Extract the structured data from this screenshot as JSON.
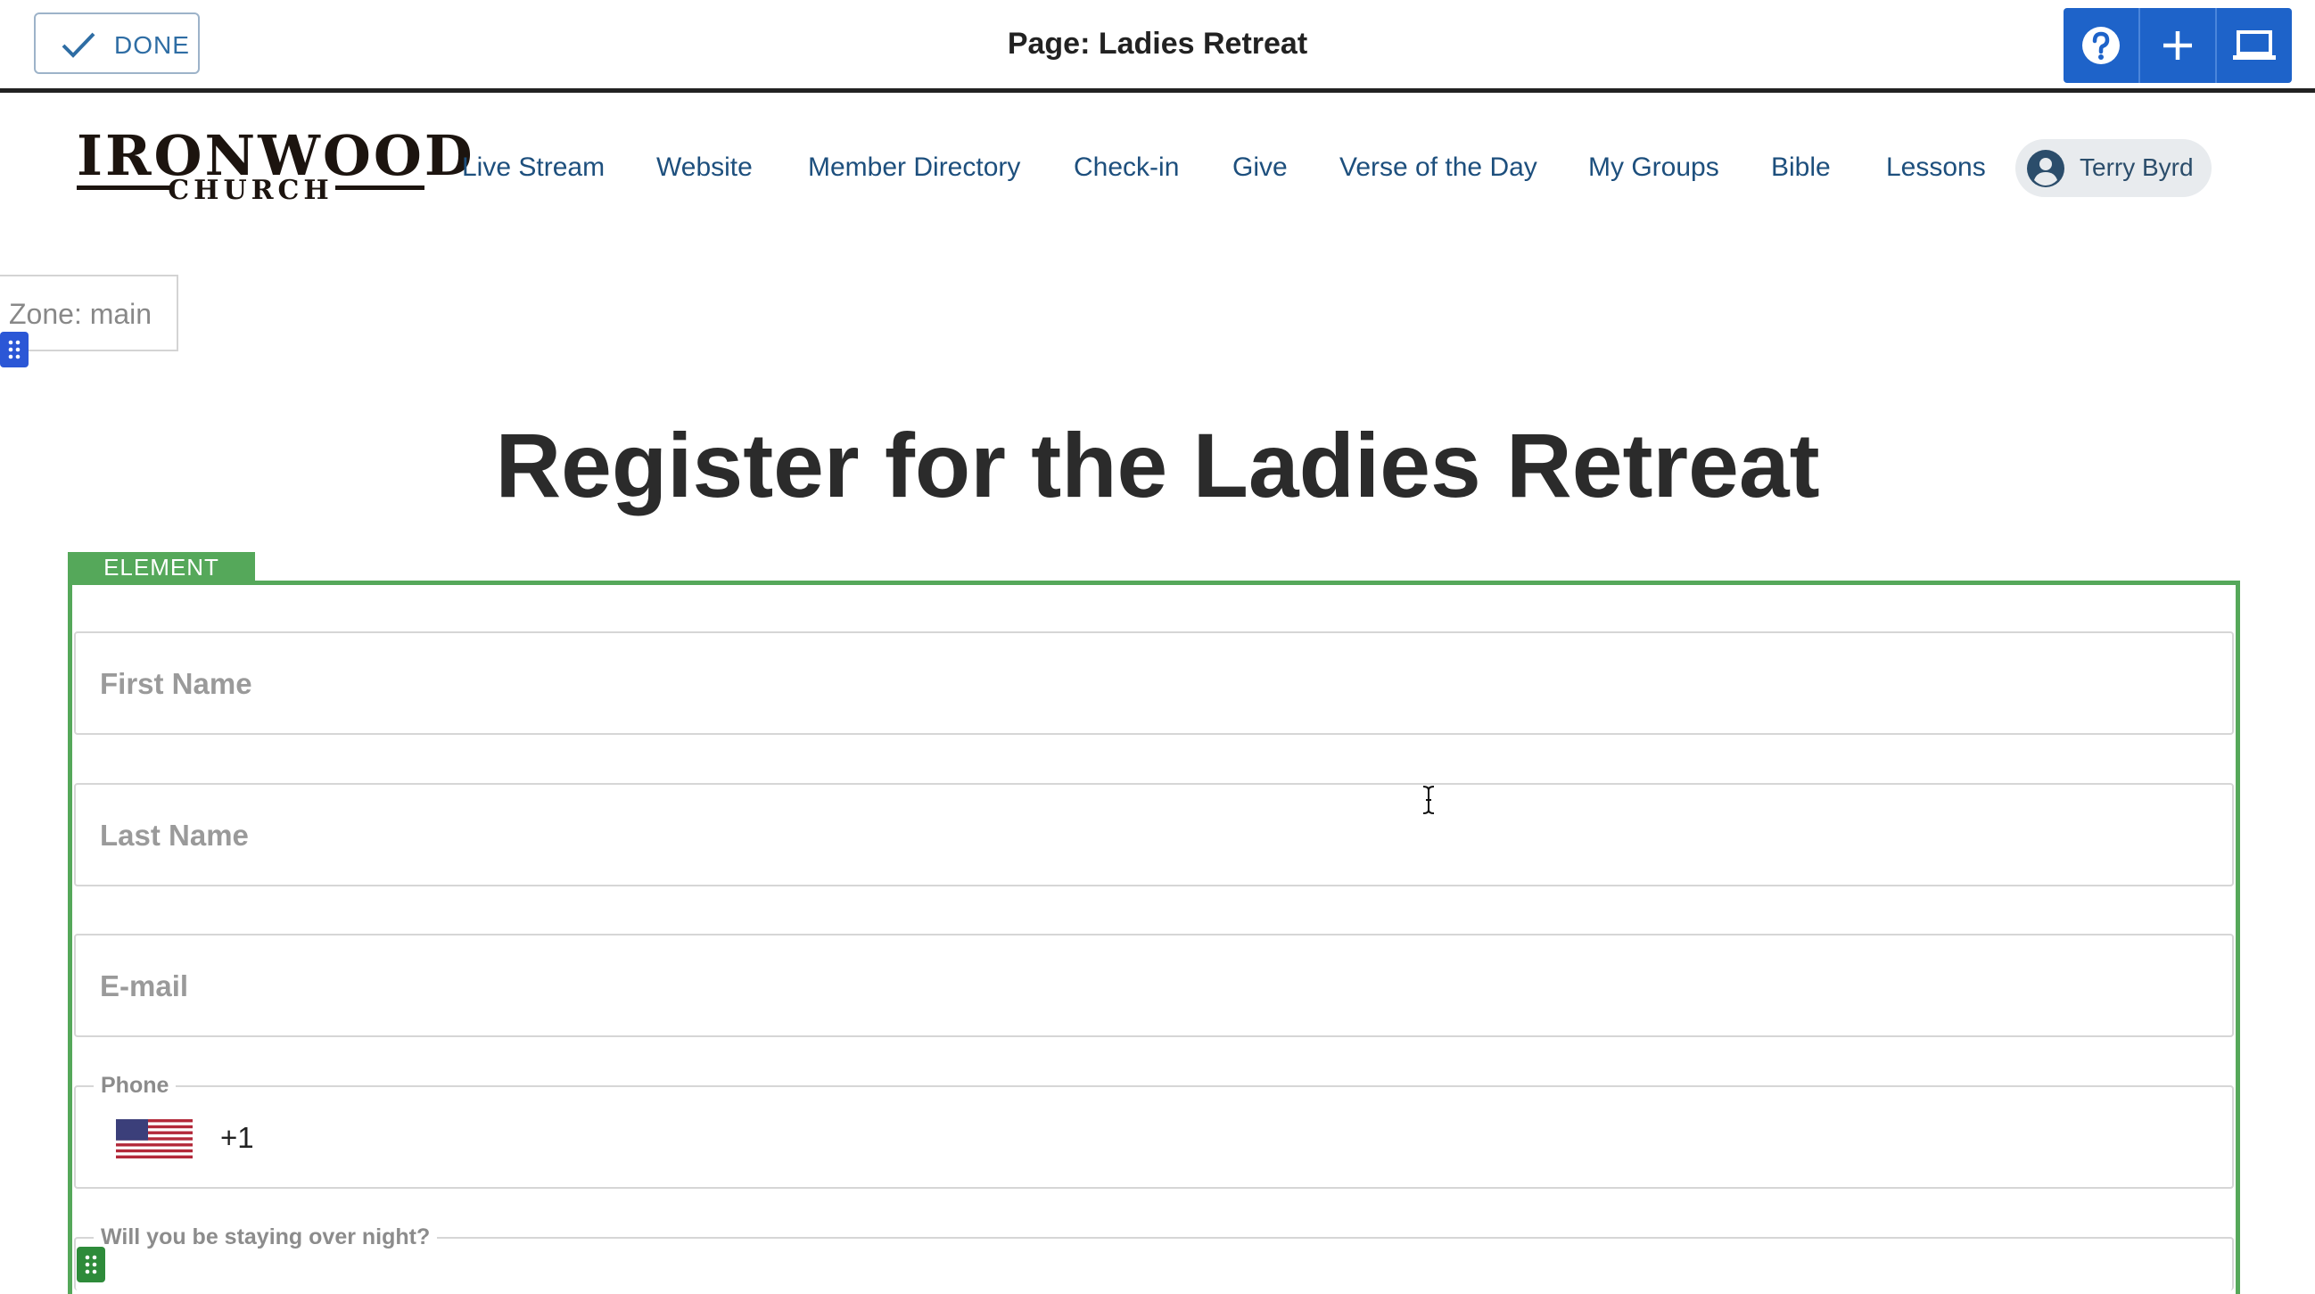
{
  "editor": {
    "done_label": "DONE",
    "page_title": "Page: Ladies Retreat",
    "tools": [
      {
        "icon": "help-icon"
      },
      {
        "icon": "plus-icon"
      },
      {
        "icon": "laptop-icon"
      }
    ]
  },
  "site": {
    "logo_line1": "IRONWOOD",
    "logo_line2": "CHURCH",
    "nav": [
      "Live Stream",
      "Website",
      "Member Directory",
      "Check-in",
      "Give",
      "Verse of the Day",
      "My Groups",
      "Bible",
      "Lessons"
    ],
    "user_name": "Terry Byrd"
  },
  "zone_label": "Zone: main",
  "heading": "Register for the Ladies Retreat",
  "element_tag": "ELEMENT",
  "form": {
    "first_name_placeholder": "First Name",
    "last_name_placeholder": "Last Name",
    "email_placeholder": "E-mail",
    "phone_label": "Phone",
    "phone_dial_code": "+1",
    "overnight_label": "Will you be staying over night?"
  },
  "colors": {
    "accent_blue": "#1e63c9",
    "element_green": "#55a85a",
    "nav_link": "#1d4f7d"
  }
}
